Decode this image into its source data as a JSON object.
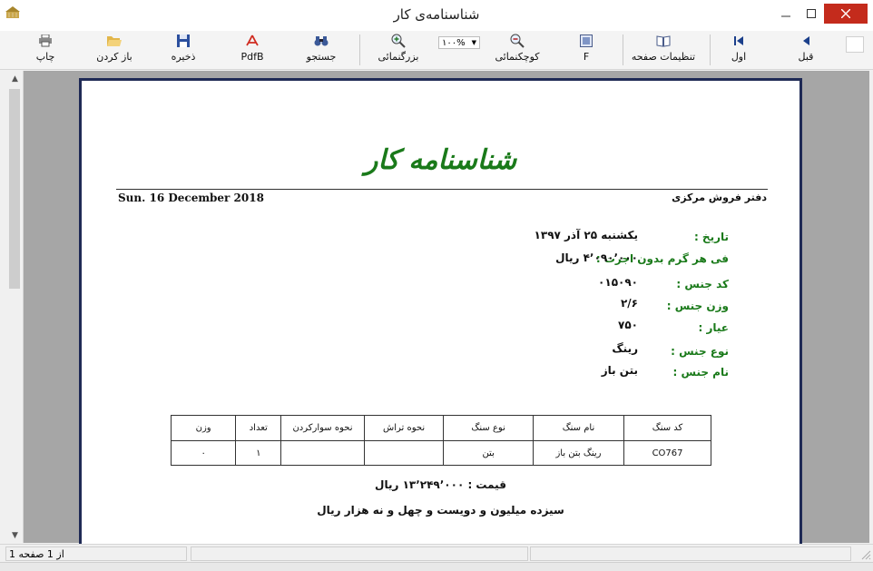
{
  "window": {
    "title": "شناسنامه‌ی کار"
  },
  "toolbar": {
    "print": "چاپ",
    "open": "باز کردن",
    "save": "ذخیره",
    "pdf": "PdfB",
    "search": "جستجو",
    "zoom_in": "بزرگنمائی",
    "zoom_value": "۱۰۰%",
    "zoom_out": "کوچکنمائی",
    "f": "F",
    "page_setup": "تنظیمات صفحه",
    "first": "اول",
    "prev": "قبل"
  },
  "report": {
    "heading": "شناسنامه کار",
    "date_en": "Sun. 16 December 2018",
    "office": "دفتر فروش مرکزی",
    "fields": [
      {
        "label": "تاریخ :",
        "value": "یکشنبه ۲۵ آذر ۱۳۹۷"
      },
      {
        "label": "فی هر گرم بدون اجرت :",
        "value": "۴٬۰۹۰٬۰۰۰ ریال"
      },
      {
        "label": "کد جنس :",
        "value": "۰۱۵۰۹۰"
      },
      {
        "label": "وزن جنس :",
        "value": "۲/۶"
      },
      {
        "label": "عیار :",
        "value": "۷۵۰"
      },
      {
        "label": "نوع جنس :",
        "value": "رینگ"
      },
      {
        "label": "نام جنس :",
        "value": "بتن باز"
      }
    ],
    "table": {
      "headers": [
        "کد سنگ",
        "نام سنگ",
        "نوع سنگ",
        "نحوه تراش",
        "نحوه سوارکردن",
        "تعداد",
        "وزن"
      ],
      "rows": [
        [
          "CO767",
          "رینگ بتن باز",
          "بتن",
          "",
          "",
          "۱",
          "۰"
        ]
      ]
    },
    "price": "قیمت : ۱۳٬۲۴۹٬۰۰۰ ریال",
    "price_words": "سیزده میلیون و دویست و چهل و نه هزار  ریال"
  },
  "status": {
    "page": "1 از 1 صفحه"
  },
  "colors": {
    "label_green": "#1a7a1a",
    "heading_green": "#1a7a1a",
    "close_red": "#c42b1c",
    "page_border": "#1f2a55"
  }
}
